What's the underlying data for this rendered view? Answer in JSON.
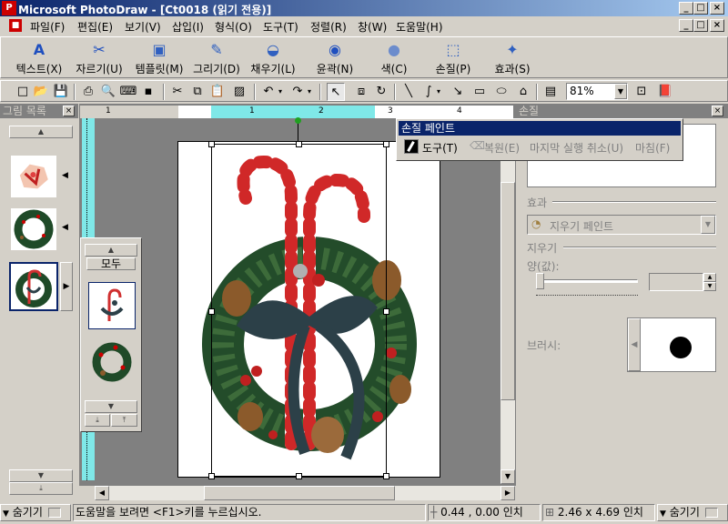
{
  "window": {
    "title": "Microsoft PhotoDraw - [Ct0018 (읽기 전용)]",
    "app_icon": "photodraw-icon"
  },
  "menu": [
    {
      "label": "파일(F)"
    },
    {
      "label": "편집(E)"
    },
    {
      "label": "보기(V)"
    },
    {
      "label": "삽입(I)"
    },
    {
      "label": "형식(O)"
    },
    {
      "label": "도구(T)"
    },
    {
      "label": "정렬(R)"
    },
    {
      "label": "창(W)"
    },
    {
      "label": "도움말(H)"
    }
  ],
  "big_toolbar": [
    {
      "label": "텍스트(X)",
      "icon": "text-icon"
    },
    {
      "label": "자르기(U)",
      "icon": "scissors-icon"
    },
    {
      "label": "템플릿(M)",
      "icon": "template-icon"
    },
    {
      "label": "그리기(D)",
      "icon": "pencil-icon"
    },
    {
      "label": "채우기(L)",
      "icon": "bucket-icon"
    },
    {
      "label": "윤곽(N)",
      "icon": "outline-icon"
    },
    {
      "label": "색(C)",
      "icon": "color-icon"
    },
    {
      "label": "손질(P)",
      "icon": "touchup-icon"
    },
    {
      "label": "효과(S)",
      "icon": "effects-icon"
    }
  ],
  "standard_toolbar": {
    "zoom": "81%"
  },
  "picture_list": {
    "title": "그림 목록",
    "flyout_all": "모두"
  },
  "ruler": {
    "ticks": [
      "1",
      "1",
      "2",
      "3",
      "4"
    ]
  },
  "popup_menu": {
    "title": "손질 페인트",
    "items": [
      {
        "label": "도구(T)",
        "enabled": true
      },
      {
        "label": "복원(E)",
        "enabled": false
      },
      {
        "label": "마지막 실행 취소(U)",
        "enabled": false
      },
      {
        "label": "마침(F)",
        "enabled": false
      }
    ]
  },
  "touchup_panel": {
    "title": "손질",
    "effect_label": "효과",
    "effect_value": "지우기 페인트",
    "erase_label": "지우기",
    "amount_label": "양(값):",
    "brush_label": "브러시:"
  },
  "status": {
    "hide_left": "숨기기",
    "help_text": "도움말을 보려면 <F1>키를 누르십시오.",
    "position": "0.44 , 0.00 인치",
    "size": "2.46 x 4.69 인치",
    "hide_right": "숨기기"
  }
}
